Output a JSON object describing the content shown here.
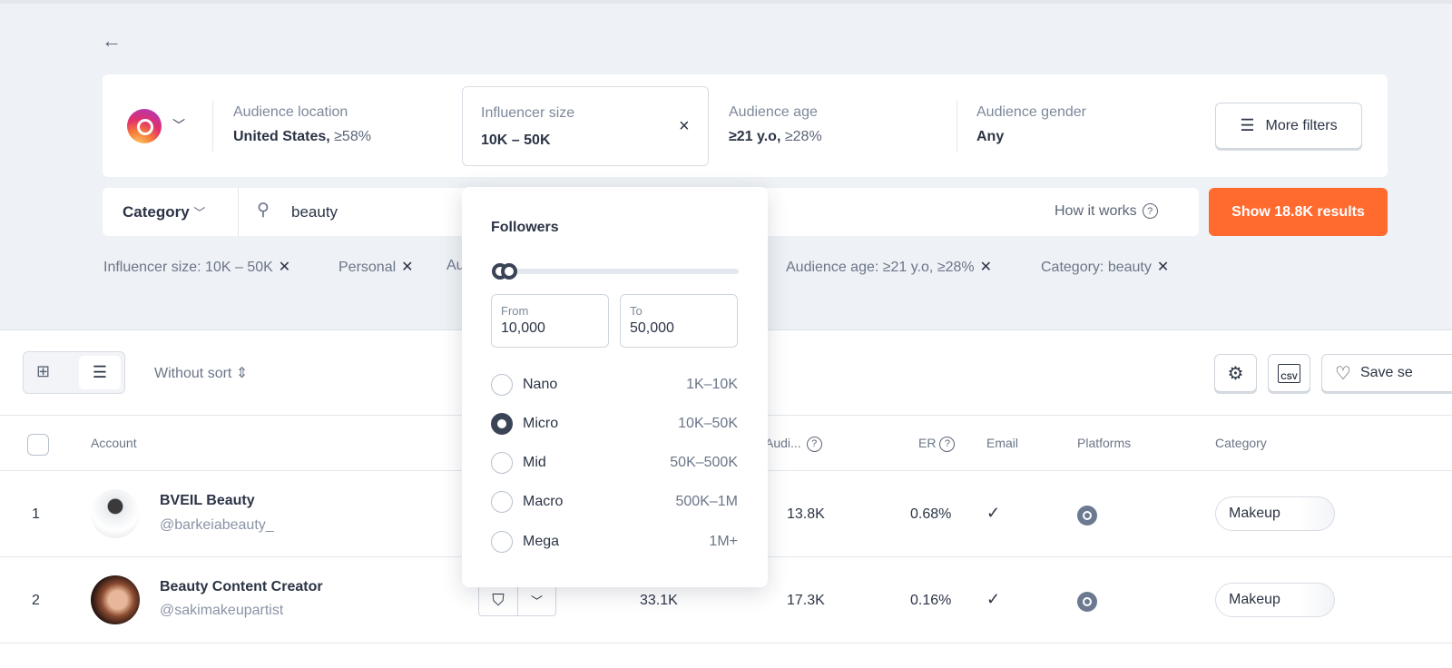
{
  "filters": {
    "location_label": "Audience location",
    "location_value": "United States,",
    "location_pct": "≥58%",
    "size_label": "Influencer size",
    "size_value": "10K – 50K",
    "age_label": "Audience age",
    "age_value": "≥21 y.o,",
    "age_pct": "≥28%",
    "gender_label": "Audience gender",
    "gender_value": "Any",
    "more_filters": "More filters"
  },
  "search": {
    "category": "Category",
    "query": "beauty",
    "how_it_works": "How it works",
    "show_results": "Show 18.8K results"
  },
  "chips": [
    "Influencer size: 10K – 50K",
    "Personal",
    "Au",
    "Audience age: ≥21 y.o, ≥28%",
    "Category: beauty"
  ],
  "dropdown": {
    "title": "Followers",
    "from_label": "From",
    "from_value": "10,000",
    "to_label": "To",
    "to_value": "50,000",
    "options": [
      {
        "name": "Nano",
        "range": "1K–10K",
        "selected": false
      },
      {
        "name": "Micro",
        "range": "10K–50K",
        "selected": true
      },
      {
        "name": "Mid",
        "range": "50K–500K",
        "selected": false
      },
      {
        "name": "Macro",
        "range": "500K–1M",
        "selected": false
      },
      {
        "name": "Mega",
        "range": "1M+",
        "selected": false
      }
    ]
  },
  "toolbar": {
    "sort": "Without sort",
    "save": "Save se",
    "csv": "CSV"
  },
  "table": {
    "headers": {
      "account": "Account",
      "audience": "Audi...",
      "er": "ER",
      "email": "Email",
      "platforms": "Platforms",
      "category": "Category"
    },
    "rows": [
      {
        "num": "1",
        "name": "BVEIL Beauty",
        "handle": "@barkeiabeauty_",
        "followers": "",
        "audience": "13.8K",
        "er": "0.68%",
        "email": "✓",
        "category": "Makeup"
      },
      {
        "num": "2",
        "name": "Beauty Content Creator",
        "handle": "@sakimakeupartist",
        "followers": "33.1K",
        "audience": "17.3K",
        "er": "0.16%",
        "email": "✓",
        "category": "Makeup"
      }
    ]
  },
  "colors": {
    "accent": "#ff6a2f",
    "background": "#eef1f5",
    "text": "#2b3445"
  }
}
